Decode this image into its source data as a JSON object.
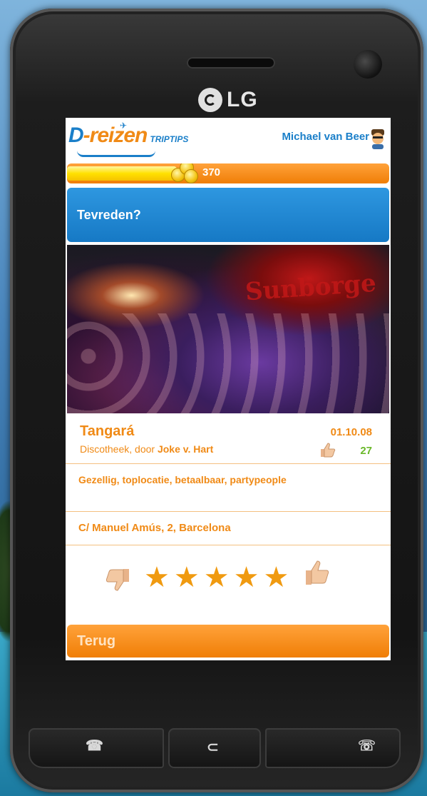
{
  "phone": {
    "brand": "LG"
  },
  "app": {
    "logo_text": "D-reizen",
    "logo_letter": "D",
    "logo_rest": "-reizen",
    "logo_sub": "TRIPTIPS",
    "user_name": "Michael van Beer",
    "points": "370",
    "points_progress": 0.34,
    "question": "Tevreden?"
  },
  "venue": {
    "name": "Tangará",
    "type": "Discotheek, door",
    "author": "Joke v. Hart",
    "date": "01.10.08",
    "likes": "27",
    "tags": "Gezellig, toplocatie, betaalbaar, partypeople",
    "address": "C/ Manuel Amús, 2, Barcelona",
    "photo_sign": "Sunborge"
  },
  "rating": {
    "stars": 5,
    "star_glyph": "★"
  },
  "actions": {
    "back_label": "Terug"
  },
  "icons": {
    "call": "phone-call-icon",
    "menu": "menu-icon",
    "end": "end-call-icon"
  },
  "colors": {
    "orange": "#f08a16",
    "blue": "#1a7fc9",
    "green": "#6ab82a",
    "star": "#f09a10"
  }
}
